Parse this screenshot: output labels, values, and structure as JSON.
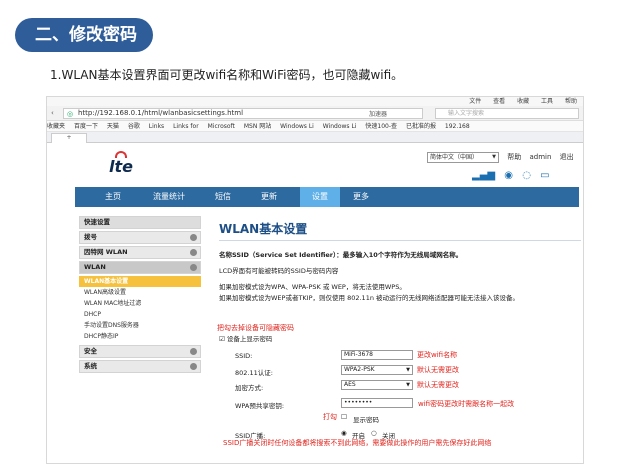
{
  "header": {
    "pill": "二、修改密码",
    "intro": "1.WLAN基本设置界面可更改wifi名称和WiFi密码，也可隐藏wifi。"
  },
  "browser": {
    "menu": [
      "文件",
      "查看",
      "收藏",
      "工具",
      "帮助"
    ],
    "url": "http://192.168.0.1/html/wlanbasicsettings.html",
    "accelerator": "加速器",
    "search_placeholder": "输入文字搜索",
    "bookmarks": [
      "收藏夹",
      "百度一下",
      "天猫",
      "谷歌",
      "Links",
      "Links for",
      "Microsoft",
      "MSN 网站",
      "Windows Li",
      "Windows Li",
      "快速100-查",
      "已批准的报",
      "192.168"
    ],
    "tab": "+"
  },
  "router": {
    "logo": "lte",
    "lang": "简体中文（中国）",
    "help": "帮助",
    "user": "admin",
    "logout": "退出",
    "nav": [
      "主页",
      "流量统计",
      "短信",
      "更新",
      "设置",
      "更多"
    ],
    "sidebar": {
      "groups": [
        {
          "label": "快速设置"
        },
        {
          "label": "拨号"
        },
        {
          "label": "因特网 WLAN"
        },
        {
          "label": "WLAN"
        }
      ],
      "wlan_items": [
        "WLAN基本设置",
        "WLAN高级设置",
        "WLAN MAC地址过滤",
        "DHCP",
        "手动设置DNS服务器",
        "DHCP静态IP"
      ],
      "after_groups": [
        {
          "label": "安全"
        },
        {
          "label": "系统"
        }
      ]
    },
    "page_title": "WLAN基本设置",
    "desc": [
      "名称SSID（Service Set Identifier）：最多输入10个字符作为无线局域网名称。",
      "LCD界面有可能被转码的SSID与密码内容",
      "如果加密模式设为WPA、WPA-PSK 或 WEP，将无法使用WPS。",
      "如果加密模式设为WEP或者TKIP，则仅使用 802.11n 被动运行的无线网络适配器可能无法接入该设备。"
    ],
    "checkbox_label": "设备上显示密码",
    "form": {
      "ssid_label": "SSID:",
      "ssid_value": "MiFi-3678",
      "mode_label": "802.11认证:",
      "mode_value": "WPA2-PSK",
      "enc_label": "加密方式:",
      "enc_value": "AES",
      "key_label": "WPA预共享密钥:",
      "key_value": "••••••••",
      "show_pwd": "显示密码",
      "broadcast_label": "SSID广播:",
      "broadcast_on": "开启",
      "broadcast_off": "关闭"
    },
    "annotations": {
      "hide_tip": "把勾去掉设备可隐藏密码",
      "ssid_tip": "更改wifi名称",
      "default_tip": "默认无需更改",
      "default_tip2": "默认无需更改",
      "key_tip": "wifi密码更改时需跟名称一起改",
      "tick_tip": "打勾",
      "broadcast_tip": "SSID广播关闭时任何设备都将搜索不到此网络，需要做此操作的用户需先保存好此网络"
    }
  }
}
